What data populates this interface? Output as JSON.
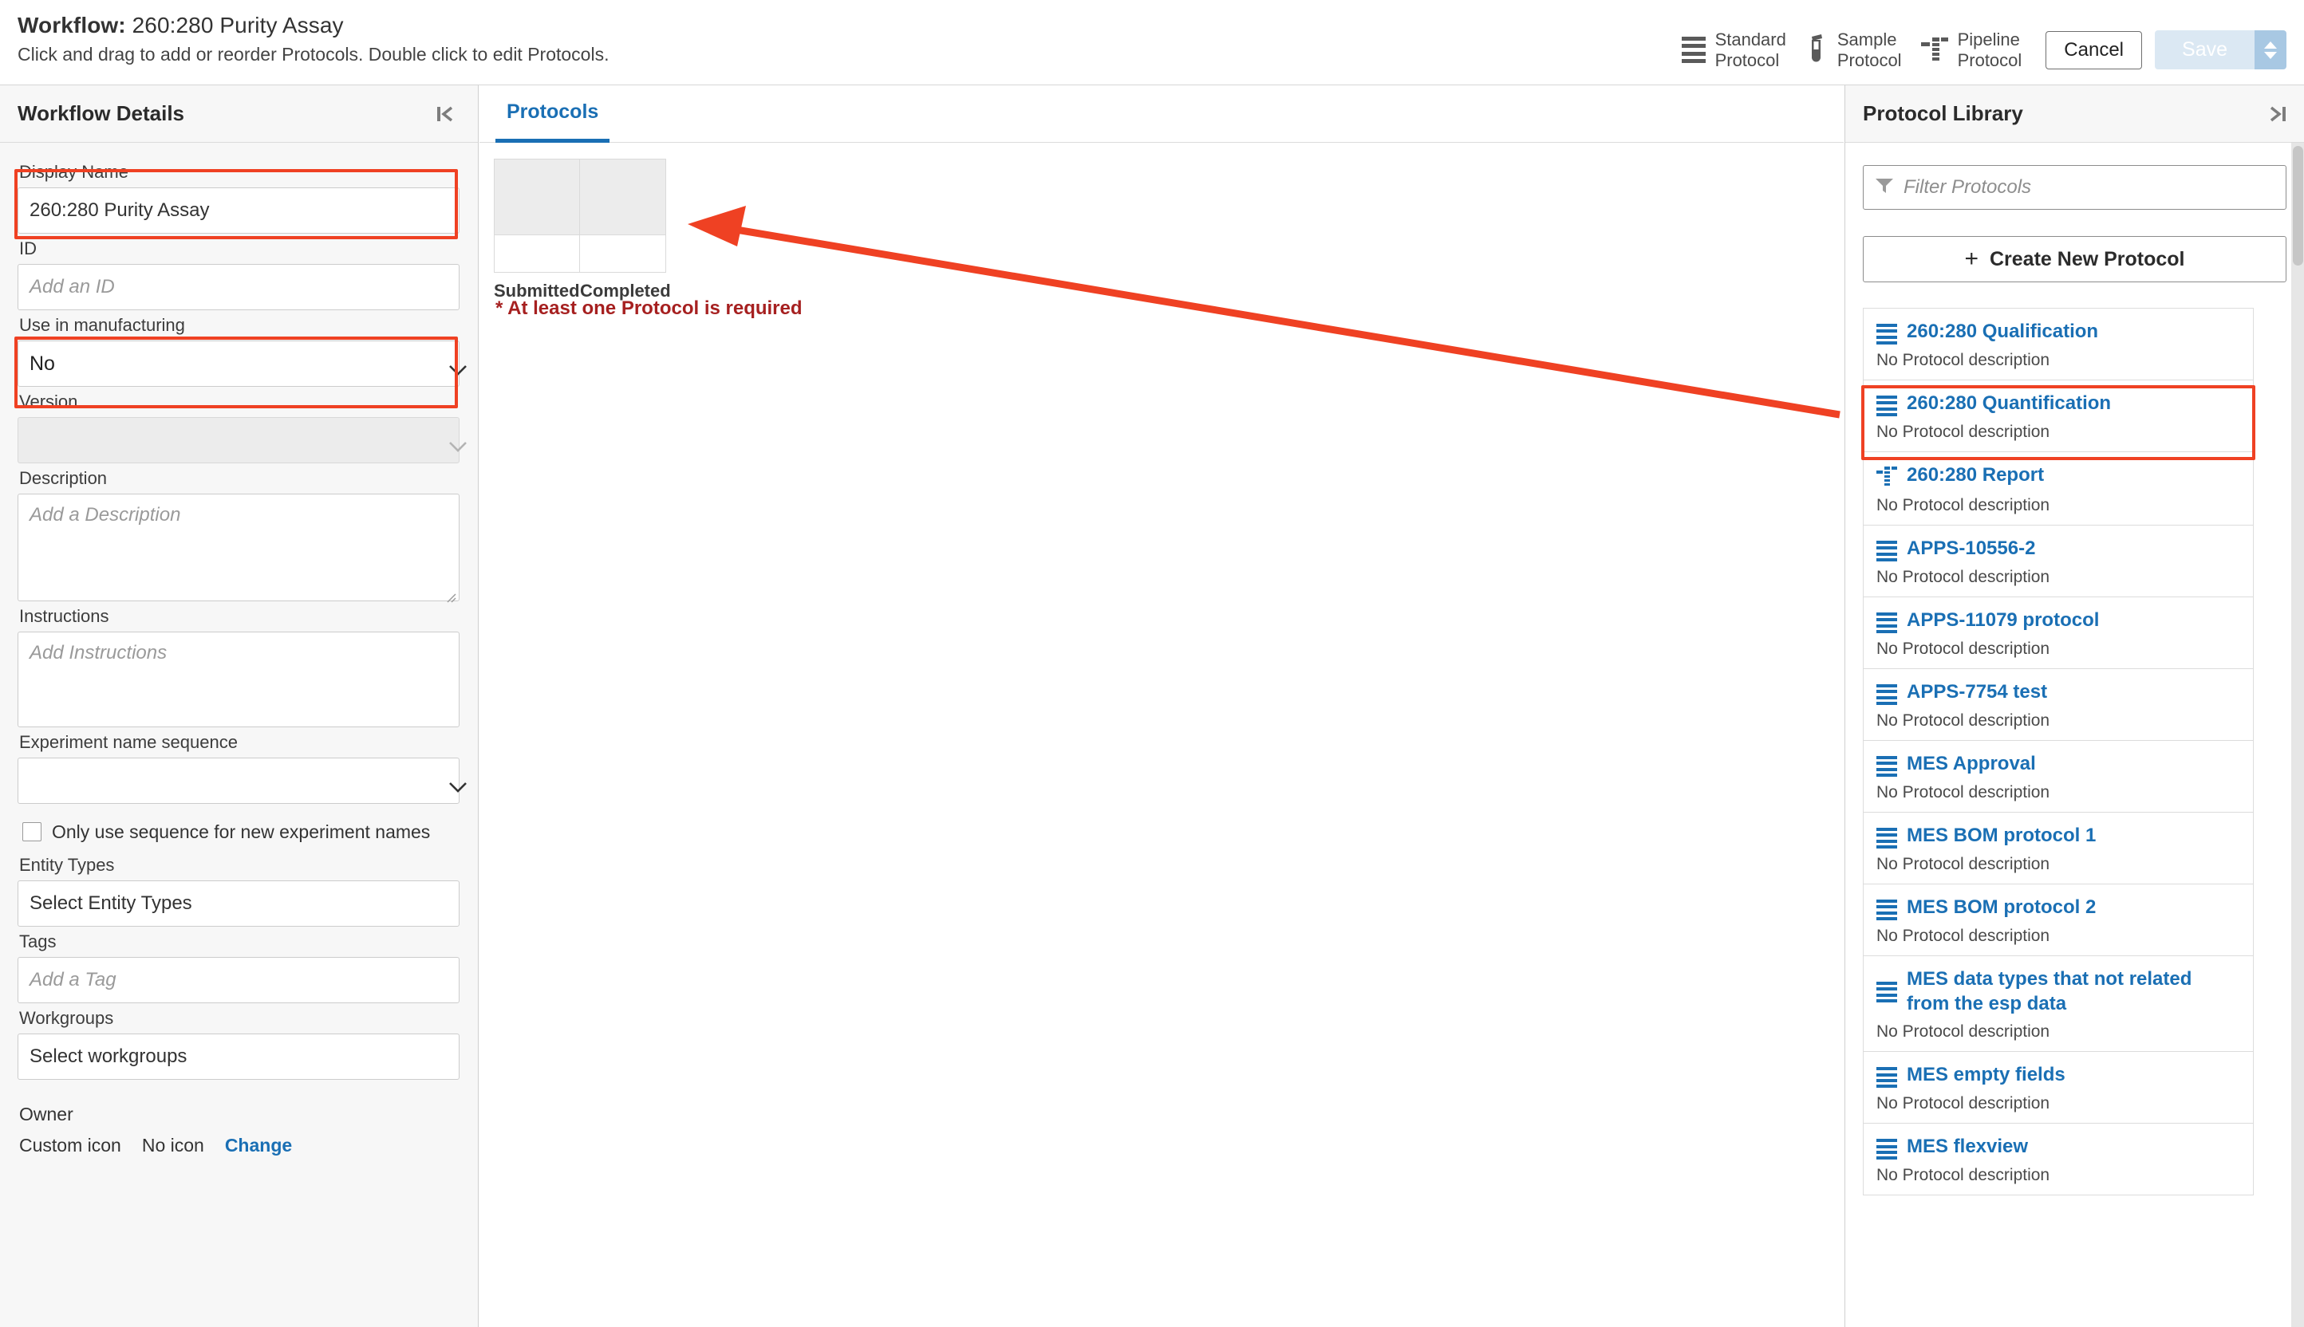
{
  "header": {
    "title_prefix": "Workflow:",
    "title_value": "260:280 Purity Assay",
    "subtitle": "Click and drag to add or reorder Protocols. Double click to edit Protocols.",
    "actions": [
      {
        "label_line1": "Standard",
        "label_line2": "Protocol",
        "icon": "standard-protocol-icon"
      },
      {
        "label_line1": "Sample",
        "label_line2": "Protocol",
        "icon": "sample-protocol-icon"
      },
      {
        "label_line1": "Pipeline",
        "label_line2": "Protocol",
        "icon": "pipeline-protocol-icon"
      }
    ],
    "cancel_label": "Cancel",
    "save_label": "Save",
    "save_disabled": true
  },
  "left_panel": {
    "title": "Workflow Details",
    "collapse_icon": "collapse-left-icon",
    "fields": {
      "display_name": {
        "label": "Display Name",
        "value": "260:280 Purity Assay",
        "highlighted": true
      },
      "id": {
        "label": "ID",
        "placeholder": "Add an ID",
        "value": ""
      },
      "use_in_manufacturing": {
        "label": "Use in manufacturing",
        "value": "No",
        "highlighted": true
      },
      "version": {
        "label": "Version",
        "value": "",
        "disabled": true
      },
      "description": {
        "label": "Description",
        "placeholder": "Add a Description"
      },
      "instructions": {
        "label": "Instructions",
        "placeholder": "Add Instructions"
      },
      "experiment_name_sequence": {
        "label": "Experiment name sequence",
        "value": ""
      },
      "only_use_sequence": {
        "label": "Only use sequence for new experiment names",
        "checked": false
      },
      "entity_types": {
        "label": "Entity Types",
        "value": "Select Entity Types"
      },
      "tags": {
        "label": "Tags",
        "placeholder": "Add a Tag"
      },
      "workgroups": {
        "label": "Workgroups",
        "value": "Select workgroups"
      },
      "owner": {
        "label": "Owner"
      },
      "custom_icon": {
        "label": "Custom icon",
        "value": "No icon",
        "action": "Change"
      }
    }
  },
  "center": {
    "tabs": [
      {
        "label": "Protocols",
        "active": true
      }
    ],
    "dropzone_columns": [
      "Submitted",
      "Completed"
    ],
    "required_message": "* At least one Protocol is required"
  },
  "right_panel": {
    "title": "Protocol Library",
    "collapse_icon": "collapse-right-icon",
    "filter_placeholder": "Filter Protocols",
    "filter_icon": "filter-icon",
    "create_button": "Create New Protocol",
    "protocols": [
      {
        "name": "260:280 Qualification",
        "description": "No Protocol description",
        "icon": "standard-protocol-icon",
        "highlighted": false
      },
      {
        "name": "260:280 Quantification",
        "description": "No Protocol description",
        "icon": "standard-protocol-icon",
        "highlighted": true
      },
      {
        "name": "260:280 Report",
        "description": "No Protocol description",
        "icon": "pipeline-protocol-icon",
        "highlighted": false
      },
      {
        "name": "APPS-10556-2",
        "description": "No Protocol description",
        "icon": "standard-protocol-icon",
        "highlighted": false
      },
      {
        "name": "APPS-11079 protocol",
        "description": "No Protocol description",
        "icon": "standard-protocol-icon",
        "highlighted": false
      },
      {
        "name": "APPS-7754 test",
        "description": "No Protocol description",
        "icon": "standard-protocol-icon",
        "highlighted": false
      },
      {
        "name": "MES Approval",
        "description": "No Protocol description",
        "icon": "standard-protocol-icon",
        "highlighted": false
      },
      {
        "name": "MES BOM protocol 1",
        "description": "No Protocol description",
        "icon": "standard-protocol-icon",
        "highlighted": false
      },
      {
        "name": "MES BOM protocol 2",
        "description": "No Protocol description",
        "icon": "standard-protocol-icon",
        "highlighted": false
      },
      {
        "name": "MES data types that not related from the esp data",
        "description": "No Protocol description",
        "icon": "standard-protocol-icon",
        "highlighted": false
      },
      {
        "name": "MES empty fields",
        "description": "No Protocol description",
        "icon": "standard-protocol-icon",
        "highlighted": false
      },
      {
        "name": "MES flexview",
        "description": "No Protocol description",
        "icon": "standard-protocol-icon",
        "highlighted": false
      }
    ]
  },
  "annotation": {
    "color": "#ef4123",
    "arrow_from": "260:280 Quantification protocol library item",
    "arrow_to": "Completed drop zone cell"
  }
}
